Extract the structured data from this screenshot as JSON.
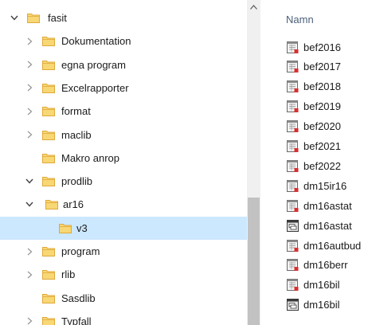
{
  "tree": {
    "items": [
      {
        "label": "fasit",
        "expanded": true,
        "chevron": "chevron-down-icon",
        "level": 0,
        "selected": false
      },
      {
        "label": "Dokumentation",
        "expanded": false,
        "chevron": "chevron-right-icon",
        "level": 1,
        "selected": false
      },
      {
        "label": "egna program",
        "expanded": false,
        "chevron": "chevron-right-icon",
        "level": 1,
        "selected": false
      },
      {
        "label": "Excelrapporter",
        "expanded": false,
        "chevron": "chevron-right-icon",
        "level": 1,
        "selected": false
      },
      {
        "label": "format",
        "expanded": false,
        "chevron": "chevron-right-icon",
        "level": 1,
        "selected": false
      },
      {
        "label": "maclib",
        "expanded": false,
        "chevron": "chevron-right-icon",
        "level": 1,
        "selected": false
      },
      {
        "label": "Makro anrop",
        "expanded": false,
        "chevron": "none",
        "level": 1,
        "selected": false
      },
      {
        "label": "prodlib",
        "expanded": true,
        "chevron": "chevron-down-icon",
        "level": 1,
        "selected": false
      },
      {
        "label": "ar16",
        "expanded": true,
        "chevron": "chevron-down-icon",
        "level": 2,
        "selected": false
      },
      {
        "label": "v3",
        "expanded": false,
        "chevron": "none",
        "level": 3,
        "selected": true
      },
      {
        "label": "program",
        "expanded": false,
        "chevron": "chevron-right-icon",
        "level": 1,
        "selected": false
      },
      {
        "label": "rlib",
        "expanded": false,
        "chevron": "chevron-right-icon",
        "level": 1,
        "selected": false
      },
      {
        "label": "Sasdlib",
        "expanded": false,
        "chevron": "none",
        "level": 1,
        "selected": false
      },
      {
        "label": "Typfall",
        "expanded": false,
        "chevron": "chevron-right-icon",
        "level": 1,
        "selected": false
      }
    ]
  },
  "files": {
    "column_header": "Namn",
    "items": [
      {
        "label": "bef2016",
        "icon": "sas-dataset-icon"
      },
      {
        "label": "bef2017",
        "icon": "sas-dataset-icon"
      },
      {
        "label": "bef2018",
        "icon": "sas-dataset-icon"
      },
      {
        "label": "bef2019",
        "icon": "sas-dataset-icon"
      },
      {
        "label": "bef2020",
        "icon": "sas-dataset-icon"
      },
      {
        "label": "bef2021",
        "icon": "sas-dataset-icon"
      },
      {
        "label": "bef2022",
        "icon": "sas-dataset-icon"
      },
      {
        "label": "dm15ir16",
        "icon": "sas-dataset-icon"
      },
      {
        "label": "dm16astat",
        "icon": "sas-dataset-icon"
      },
      {
        "label": "dm16astat",
        "icon": "sas-index-icon"
      },
      {
        "label": "dm16autbud",
        "icon": "sas-dataset-icon"
      },
      {
        "label": "dm16berr",
        "icon": "sas-dataset-icon"
      },
      {
        "label": "dm16bil",
        "icon": "sas-dataset-icon"
      },
      {
        "label": "dm16bil",
        "icon": "sas-index-icon"
      }
    ]
  },
  "colors": {
    "selection": "#cce8ff",
    "folder_fill": "#f8d775",
    "folder_edge": "#e0a93a",
    "header_text": "#4c607a",
    "scrollbar_track": "#f0f0f0",
    "scrollbar_thumb": "#c2c2c2"
  }
}
